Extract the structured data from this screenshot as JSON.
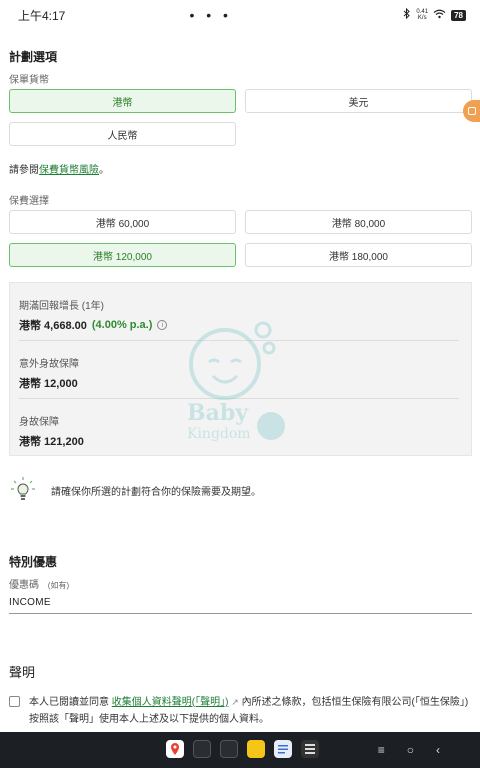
{
  "status_bar": {
    "time": "上午4:17",
    "dots": "• • •",
    "net_speed": "0.41",
    "net_unit": "K/s",
    "battery": "78"
  },
  "plan": {
    "title": "計劃選項",
    "currency_label": "保單貨幣",
    "currencies": [
      "港幣",
      "美元",
      "人民幣"
    ],
    "selected_currency": "港幣",
    "risk_prefix": "請參閱",
    "risk_link": "保費貨幣風險",
    "risk_suffix": "。",
    "premium_label": "保費選擇",
    "premiums": [
      "港幣 60,000",
      "港幣 80,000",
      "港幣 120,000",
      "港幣 180,000"
    ],
    "selected_premium": "港幣 120,000"
  },
  "summary": {
    "items": [
      {
        "label": "期滿回報增長 (1年)",
        "value": "港幣 4,668.00",
        "rate": "(4.00% p.a.)"
      },
      {
        "label": "意外身故保障",
        "value": "港幣 12,000"
      },
      {
        "label": "身故保障",
        "value": "港幣 121,200"
      }
    ],
    "watermark_line1": "Baby",
    "watermark_line2": "Kingdom"
  },
  "tip": {
    "text": "請確保你所選的計劃符合你的保險需要及期望。",
    "icon": "lightbulb-icon"
  },
  "promo": {
    "title": "特別優惠",
    "code_label": "優惠碼",
    "optional": "(如有)",
    "code_value": "INCOME"
  },
  "declaration": {
    "title": "聲明",
    "text_before": "本人已閱讀並同意",
    "link": "收集個人資料聲明(「聲明」)",
    "text_after": "內所述之條款，包括恒生保險有限公司(「恒生保險」)按照該「聲明」使用本人上述及以下提供的個人資料。"
  },
  "colors": {
    "accent": "#2d7d2d",
    "selected_bg": "#eaf7ea",
    "nav_bg": "#1c1f24"
  }
}
